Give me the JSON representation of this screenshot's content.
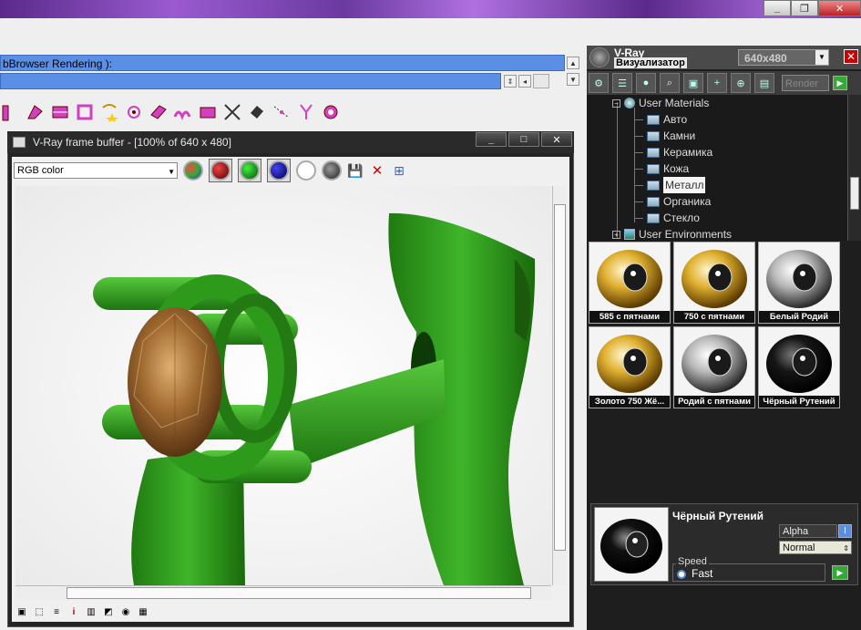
{
  "app": {
    "status_text": "bBrowser  Rendering ):"
  },
  "frame_buffer": {
    "title": "V-Ray frame buffer - [100% of 640 x 480]",
    "color_mode": "RGB color"
  },
  "visualizer": {
    "title_line1": "V-Ray",
    "title_line2": "Визуализатор",
    "resolution": "640x480",
    "render_placeholder": "Render",
    "tree": {
      "root_materials": "User Materials",
      "folders": [
        "Авто",
        "Камни",
        "Керамика",
        "Кожа",
        "Металл",
        "Органика",
        "Стекло"
      ],
      "selected_folder": "Металл",
      "root_environments": "User Environments"
    },
    "materials": [
      {
        "name": "585 с пятнами",
        "tone": "gold"
      },
      {
        "name": "750 с пятнами",
        "tone": "gold"
      },
      {
        "name": "Белый Родий",
        "tone": "silver"
      },
      {
        "name": "Золото 750 Жё...",
        "tone": "gold"
      },
      {
        "name": "Родий с пятнами",
        "tone": "silver"
      },
      {
        "name": "Чёрный Рутений",
        "tone": "black"
      }
    ],
    "detail": {
      "name": "Чёрный Рутений",
      "alpha_label": "Alpha",
      "blend_mode": "Normal",
      "speed_label": "Speed",
      "speed_value": "Fast"
    },
    "colors": {
      "panel_bg": "#1e1e1e",
      "accent_blue": "#5b8fe6",
      "render_green": "#33aa33"
    }
  }
}
